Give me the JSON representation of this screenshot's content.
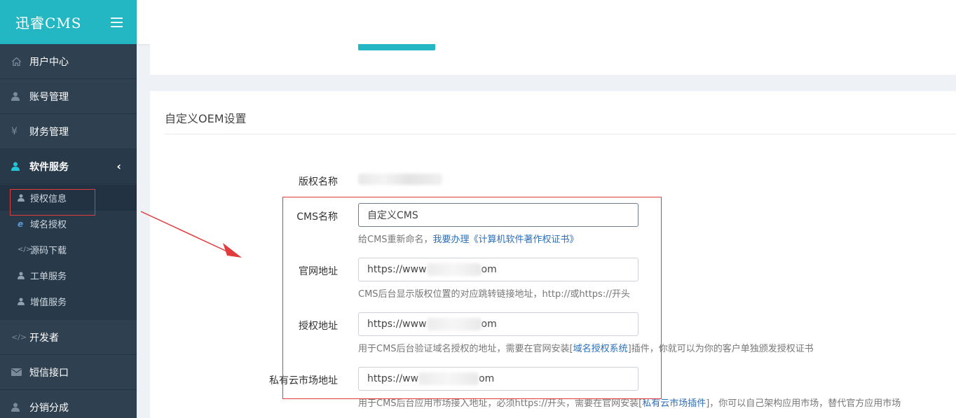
{
  "app": {
    "brand": "迅睿CMS"
  },
  "sidebar": {
    "items": [
      {
        "label": "用户中心",
        "icon": "home-icon"
      },
      {
        "label": "账号管理",
        "icon": "user-icon"
      },
      {
        "label": "财务管理",
        "icon": "yen-icon"
      },
      {
        "label": "软件服务",
        "icon": "user-icon",
        "expanded": true
      },
      {
        "label": "开发者",
        "icon": "code-icon"
      },
      {
        "label": "短信接口",
        "icon": "envelope-icon"
      },
      {
        "label": "分销分成",
        "icon": "user-icon"
      }
    ],
    "sub_items": [
      {
        "label": "授权信息",
        "icon": "user-icon"
      },
      {
        "label": "域名授权",
        "icon": "ie-icon"
      },
      {
        "label": "源码下载",
        "icon": "code-icon"
      },
      {
        "label": "工单服务",
        "icon": "user-icon"
      },
      {
        "label": "增值服务",
        "icon": "user-icon"
      }
    ]
  },
  "section": {
    "title": "自定义OEM设置",
    "copyright_label": "版权名称",
    "cms_name": {
      "label": "CMS名称",
      "value": "自定义CMS",
      "help_prefix": "给CMS重新命名，",
      "help_link": "我要办理《计算机软件著作权证书》"
    },
    "website": {
      "label": "官网地址",
      "value_start": "https://www",
      "value_end": "om",
      "help": "CMS后台显示版权位置的对应跳转链接地址，http://或https://开头"
    },
    "auth_url": {
      "label": "授权地址",
      "value_start": "https://www",
      "value_end": "om",
      "help_prefix": "用于CMS后台验证域名授权的地址，需要在官网安装[",
      "help_link": "域名授权系统",
      "help_suffix": "]插件，你就可以为你的客户单独颁发授权证书"
    },
    "market_url": {
      "label": "私有云市场地址",
      "value_start": "https://ww",
      "value_end": "om",
      "help_prefix": "用于CMS后台应用市场接入地址，必须https://开头，需要在官网安装[",
      "help_link": "私有云市场插件",
      "help_suffix": "]，你可以自己架构应用市场，替代官方应用市场"
    }
  },
  "colors": {
    "accent": "#23b7c3",
    "sidebar": "#2f4050",
    "highlight": "#e23b3b",
    "link": "#2a6fba"
  }
}
